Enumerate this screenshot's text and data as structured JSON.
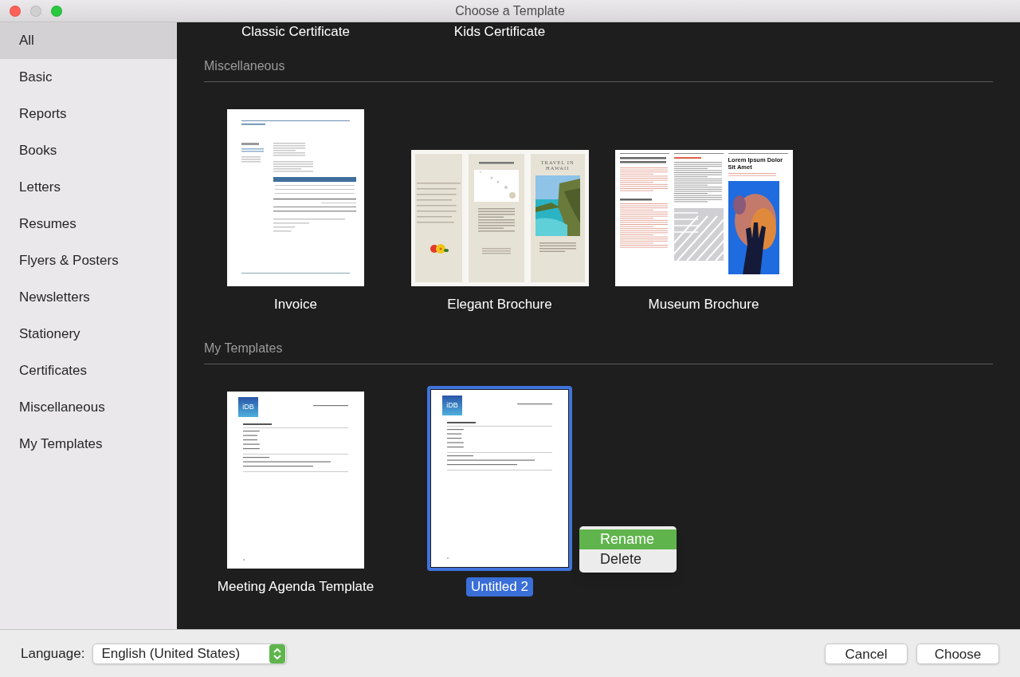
{
  "window": {
    "title": "Choose a Template",
    "buttons": [
      {
        "kind": "close",
        "disabled": false
      },
      {
        "kind": "minimize",
        "disabled": true
      },
      {
        "kind": "zoom",
        "disabled": false
      }
    ]
  },
  "sidebar": {
    "items": [
      {
        "label": "All",
        "selected": true
      },
      {
        "label": "Basic",
        "selected": false
      },
      {
        "label": "Reports",
        "selected": false
      },
      {
        "label": "Books",
        "selected": false
      },
      {
        "label": "Letters",
        "selected": false
      },
      {
        "label": "Resumes",
        "selected": false
      },
      {
        "label": "Flyers & Posters",
        "selected": false
      },
      {
        "label": "Newsletters",
        "selected": false
      },
      {
        "label": "Stationery",
        "selected": false
      },
      {
        "label": "Certificates",
        "selected": false
      },
      {
        "label": "Miscellaneous",
        "selected": false
      },
      {
        "label": "My Templates",
        "selected": false
      }
    ]
  },
  "cut_off_labels": [
    "Classic Certificate",
    "Kids Certificate"
  ],
  "sections": [
    {
      "title": "Miscellaneous",
      "templates": [
        {
          "name": "Invoice",
          "kind": "invoice",
          "selected": false
        },
        {
          "name": "Elegant Brochure",
          "kind": "brochure",
          "selected": false,
          "preview": {
            "cover_title": "TRAVEL IN HAWAII"
          }
        },
        {
          "name": "Museum Brochure",
          "kind": "museum",
          "selected": false,
          "preview": {
            "cover_title": "Lorem Ipsum Dolor Sit Amet"
          }
        }
      ]
    },
    {
      "title": "My Templates",
      "templates": [
        {
          "name": "Meeting Agenda Template",
          "kind": "agenda",
          "selected": false,
          "preview": {
            "logo": "iDB"
          }
        },
        {
          "name": "Untitled 2",
          "kind": "agenda",
          "selected": true,
          "preview": {
            "logo": "iDB"
          }
        }
      ]
    }
  ],
  "context_menu": {
    "items": [
      {
        "label": "Rename",
        "selected": true
      },
      {
        "label": "Delete",
        "selected": false
      }
    ]
  },
  "footer": {
    "language_label": "Language:",
    "language": "English (United States)",
    "buttons": [
      "Cancel",
      "Choose"
    ]
  }
}
